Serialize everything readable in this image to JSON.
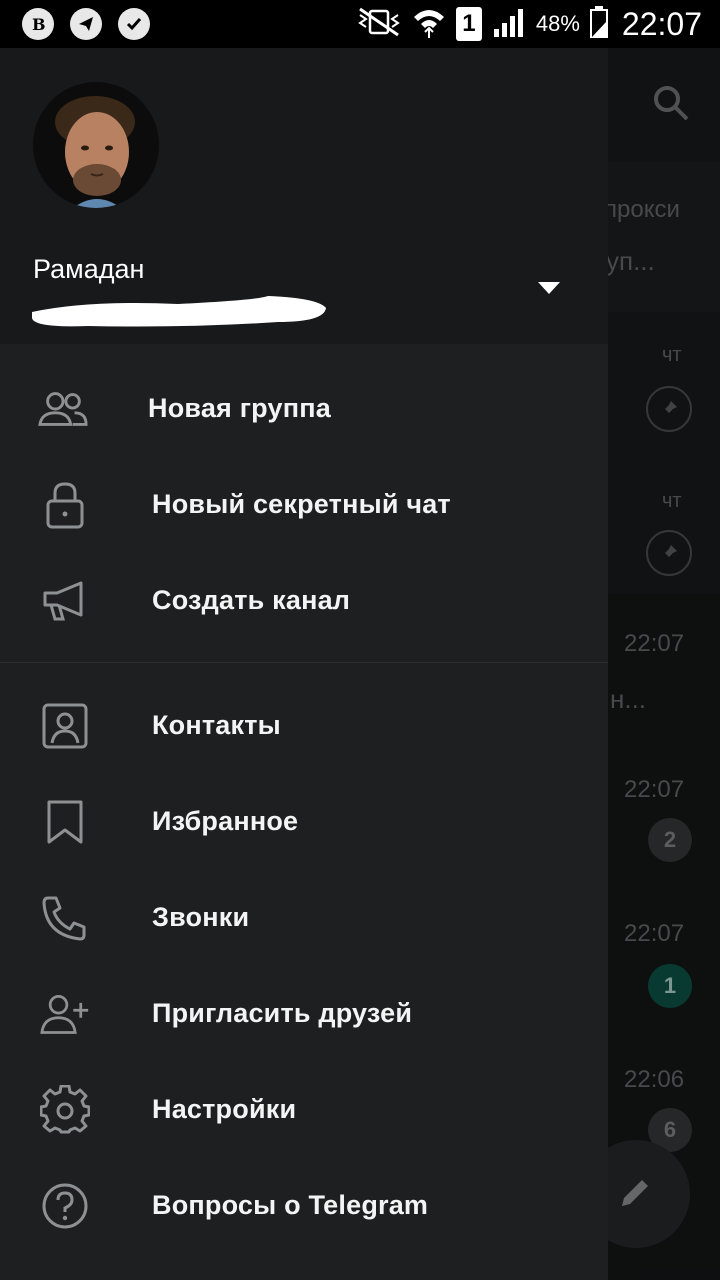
{
  "status_bar": {
    "battery": "48%",
    "time": "22:07",
    "sim": "1",
    "left_icons": [
      "vk-icon",
      "telegram-icon",
      "check-icon"
    ]
  },
  "background": {
    "proxy_text": "прокси",
    "proxy_sub": "уп...",
    "rows": [
      {
        "time": "чт"
      },
      {
        "time": "чт"
      },
      {
        "time": "22:07",
        "snippet": "н..."
      },
      {
        "time": "22:07",
        "badge": "2"
      },
      {
        "time": "22:07",
        "badge": "1"
      },
      {
        "time": "22:06",
        "badge": "6"
      }
    ]
  },
  "drawer": {
    "user_name": "Рамадан",
    "menu_group1": [
      {
        "label": "Новая группа",
        "icon": "group-icon"
      },
      {
        "label": "Новый секретный чат",
        "icon": "lock-icon"
      },
      {
        "label": "Создать канал",
        "icon": "megaphone-icon"
      }
    ],
    "menu_group2": [
      {
        "label": "Контакты",
        "icon": "contact-icon"
      },
      {
        "label": "Избранное",
        "icon": "bookmark-icon"
      },
      {
        "label": "Звонки",
        "icon": "phone-icon"
      },
      {
        "label": "Пригласить друзей",
        "icon": "add-user-icon"
      },
      {
        "label": "Настройки",
        "icon": "gear-icon"
      },
      {
        "label": "Вопросы о Telegram",
        "icon": "help-icon"
      }
    ]
  },
  "colors": {
    "drawer_bg": "#1e1f21",
    "header_bg": "#18191b",
    "accent_green": "#0e5a4e",
    "text": "#ffffff"
  }
}
